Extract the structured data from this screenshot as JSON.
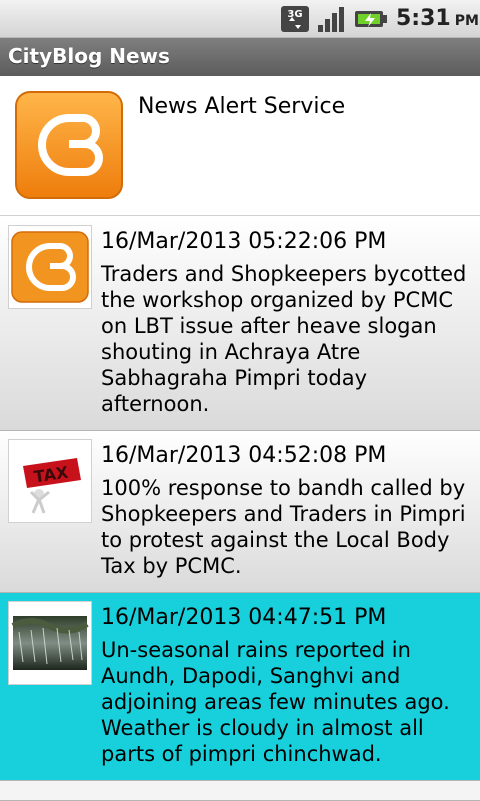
{
  "status_bar": {
    "time": "5:31",
    "ampm": "PM",
    "icons": [
      "network-3g-icon",
      "signal-strength-icon",
      "battery-charging-icon"
    ]
  },
  "app": {
    "title": "CityBlog News"
  },
  "header": {
    "service_name": "News Alert Service"
  },
  "news": [
    {
      "date": "16/Mar/2013 05:22:06 PM",
      "text": "Traders and Shopkeepers bycotted the workshop organized by PCMC on LBT issue after heave slogan shouting in Achraya Atre Sabhagraha Pimpri today afternoon.",
      "thumb": "cityblog-logo-icon"
    },
    {
      "date": "16/Mar/2013 04:52:08 PM",
      "text": "100% response to bandh called by Shopkeepers and Traders in Pimpri to protest against the Local Body Tax by PCMC.",
      "thumb": "tax-image"
    },
    {
      "date": "16/Mar/2013 04:47:51 PM",
      "text": "Un-seasonal rains reported in Aundh, Dapodi, Sanghvi and adjoining areas few minutes ago. Weather is cloudy in almost all parts of pimpri chinchwad.",
      "thumb": "rain-image",
      "selected": true
    }
  ],
  "colors": {
    "selected_bg": "#17d0dc",
    "brand_orange": "#f39a1e",
    "title_bar": "#6b6b6b"
  }
}
